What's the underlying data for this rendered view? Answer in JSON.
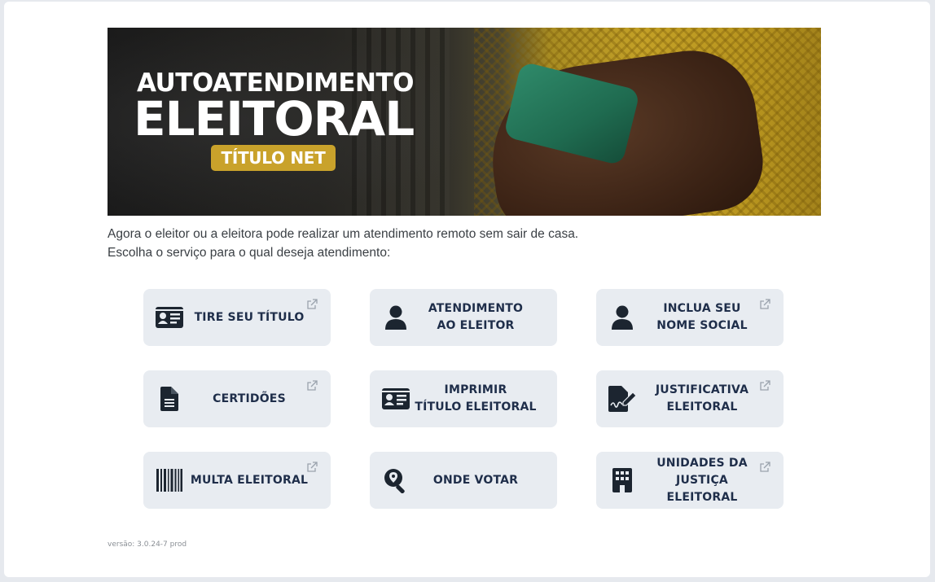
{
  "banner": {
    "title_line1": "AUTOATENDIMENTO",
    "title_line2": "ELEITORAL",
    "badge": "TÍTULO NET",
    "badge_color": "#c9a22b"
  },
  "intro": {
    "line1": "Agora o eleitor ou a eleitora pode realizar um atendimento remoto sem sair de casa.",
    "line2": "Escolha o serviço para o qual deseja atendimento:"
  },
  "services": [
    {
      "label": "TIRE SEU TÍTULO",
      "icon": "id-card-icon",
      "external": true
    },
    {
      "label": "ATENDIMENTO\nAO ELEITOR",
      "icon": "user-icon",
      "external": false
    },
    {
      "label": "INCLUA SEU\nNOME SOCIAL",
      "icon": "user-icon",
      "external": true
    },
    {
      "label": "CERTIDÕES",
      "icon": "document-icon",
      "external": true
    },
    {
      "label": "IMPRIMIR\nTÍTULO ELEITORAL",
      "icon": "id-card-icon",
      "external": false
    },
    {
      "label": "JUSTIFICATIVA\nELEITORAL",
      "icon": "signature-icon",
      "external": true
    },
    {
      "label": "MULTA ELEITORAL",
      "icon": "barcode-icon",
      "external": true
    },
    {
      "label": "ONDE VOTAR",
      "icon": "search-location-icon",
      "external": false
    },
    {
      "label": "UNIDADES DA\nJUSTIÇA ELEITORAL",
      "icon": "building-icon",
      "external": true
    }
  ],
  "colors": {
    "tile_bg": "#e8ecf1",
    "tile_text": "#1f2e4a",
    "icon": "#1c2530"
  },
  "footer": {
    "version": "versão: 3.0.24-7 prod"
  }
}
